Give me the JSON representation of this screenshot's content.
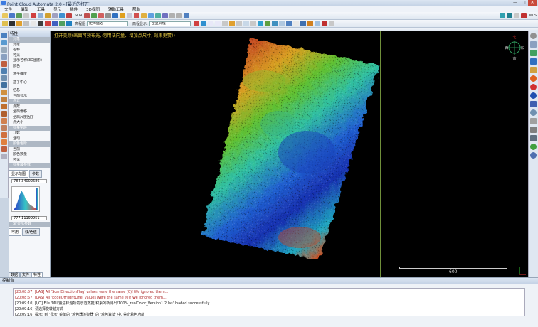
{
  "app": {
    "title": "Point Cloud Automata 2.0 - [最近的打开]"
  },
  "window_buttons": [
    "—",
    "□",
    "✕"
  ],
  "menu": [
    "文件",
    "编辑",
    "工具",
    "显示",
    "插件",
    "3D视图",
    "辅助工具",
    "帮助"
  ],
  "toolbar": {
    "sor_label": "SOR",
    "mls_label": "MLS",
    "filter_label": "滤波",
    "combo1_label": "高程图",
    "combo1_value": "矩阵延迟",
    "combo2_label": "高程显示:",
    "combo2_value": "全显高程"
  },
  "properties": {
    "header": "特性",
    "rows": [
      {
        "text": "对象",
        "type": "sec"
      },
      {
        "text": "对象",
        "type": "row"
      },
      {
        "text": "名称",
        "type": "row"
      },
      {
        "text": "可见",
        "type": "row"
      },
      {
        "text": "显示名称(3D图形)",
        "type": "row"
      },
      {
        "text": "颜色",
        "type": "row"
      },
      {
        "text": "",
        "type": "blank"
      },
      {
        "text": "盒子维度",
        "type": "row"
      },
      {
        "text": "",
        "type": "blank"
      },
      {
        "text": "盒子中心",
        "type": "row"
      },
      {
        "text": "",
        "type": "blank"
      },
      {
        "text": "信息",
        "type": "row"
      },
      {
        "text": "当前显示",
        "type": "row"
      },
      {
        "text": "点云",
        "type": "sec"
      },
      {
        "text": "点数",
        "type": "row"
      },
      {
        "text": "全局偏移",
        "type": "row"
      },
      {
        "text": "全局尺度因子",
        "type": "row"
      },
      {
        "text": "点大小",
        "type": "row"
      },
      {
        "text": "标量字段",
        "type": "sec"
      },
      {
        "text": "计数",
        "type": "row"
      },
      {
        "text": "活动",
        "type": "row"
      },
      {
        "text": "颜色色阶",
        "type": "sec"
      },
      {
        "text": "当前",
        "type": "row"
      },
      {
        "text": "颜色数量",
        "type": "row"
      },
      {
        "text": "可见",
        "type": "row"
      },
      {
        "text": "标量域参数",
        "type": "sec"
      }
    ],
    "tab_display": "显示范围",
    "tab_params": "参数",
    "max_value": "784.34002686",
    "min_value": "777.11199951",
    "sf_section": "SF显示参数",
    "tab_sf_recent": "可用",
    "tab_sf_log": "线/色值"
  },
  "bottom_tabs": [
    "数据",
    "文件",
    "特性"
  ],
  "viewport": {
    "hint": "打开美颜(画面可预布光, 勿用法向量、增加点尺寸, 效果更赞!)",
    "compass_up": "北",
    "compass_down": "南",
    "compass_left": "西",
    "compass_right": "东",
    "scale_label": "600"
  },
  "console": {
    "header": "控制台",
    "lines": [
      {
        "text": "[20:08:57] [LAS] All 'ScanDirectionFlag' values were the same (0)! We ignored them...",
        "level": "warn"
      },
      {
        "text": "[20:08:57] [LAS] All 'EdgeOfFlightLine' values were the same (0)! We ignored them...",
        "level": "warn"
      },
      {
        "text": "[20:09:10] [I/O] File 'MU/量进标题所的示范数据/积累的新测出/100%_realColor_Version1.2.las' loaded successfully",
        "level": "info"
      },
      {
        "text": "[20:09:16] 请选择旋转轴方式",
        "level": "info"
      },
      {
        "text": "[20:09:16] 提示: 到 '显示' 菜单的 '着色器渲染器' 的 '着色算法' 中, 禁止着色功能",
        "level": "info"
      }
    ]
  },
  "colors": {
    "hint": "#e0c540",
    "viewport_bg": "#000000",
    "warn": "#b03030"
  }
}
